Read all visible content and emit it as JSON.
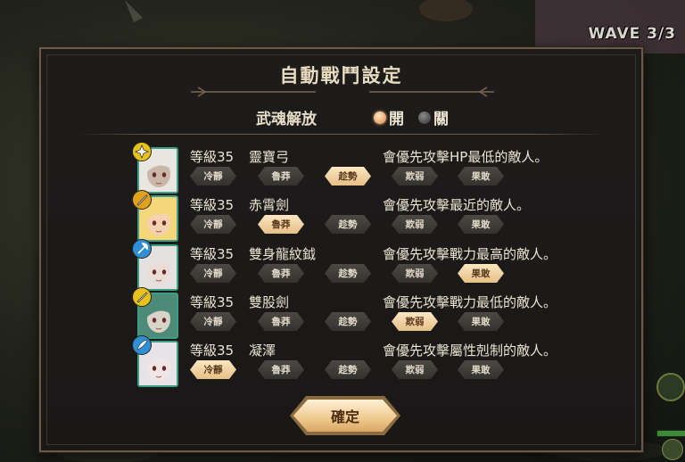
{
  "wave": "WAVE 3/3",
  "dialog": {
    "title": "自動戰鬥設定",
    "soul_release": {
      "label": "武魂解放",
      "options": [
        {
          "label": "開",
          "selected": true
        },
        {
          "label": "關",
          "selected": false
        }
      ]
    },
    "buttons": [
      "冷靜",
      "魯莽",
      "趁勢",
      "欺弱",
      "果敢"
    ],
    "characters": [
      {
        "level": "等級35",
        "weapon": "靈寶弓",
        "description": "會優先攻擊HP最低的敵人。",
        "selected_index": 2,
        "badge_color": "#e8c21c",
        "badge_icon": "shuriken-icon"
      },
      {
        "level": "等級35",
        "weapon": "赤霄劍",
        "description": "會優先攻擊最近的敵人。",
        "selected_index": 1,
        "badge_color": "#e0a020",
        "badge_icon": "sword-icon"
      },
      {
        "level": "等級35",
        "weapon": "雙身龍紋鉞",
        "description": "會優先攻擊戰力最高的敵人。",
        "selected_index": 4,
        "badge_color": "#2f8fd6",
        "badge_icon": "axe-icon"
      },
      {
        "level": "等級35",
        "weapon": "雙股劍",
        "description": "會優先攻擊戰力最低的敵人。",
        "selected_index": 3,
        "badge_color": "#e8c21c",
        "badge_icon": "sword-icon"
      },
      {
        "level": "等級35",
        "weapon": "凝澤",
        "description": "會優先攻擊屬性剋制的敵人。",
        "selected_index": 0,
        "badge_color": "#2f8fd6",
        "badge_icon": "feather-icon"
      }
    ],
    "confirm_label": "確定"
  },
  "colors": {
    "accent": "#f0c98e",
    "panel_border": "#6b5a45",
    "portrait_border": "#3d9e86"
  }
}
